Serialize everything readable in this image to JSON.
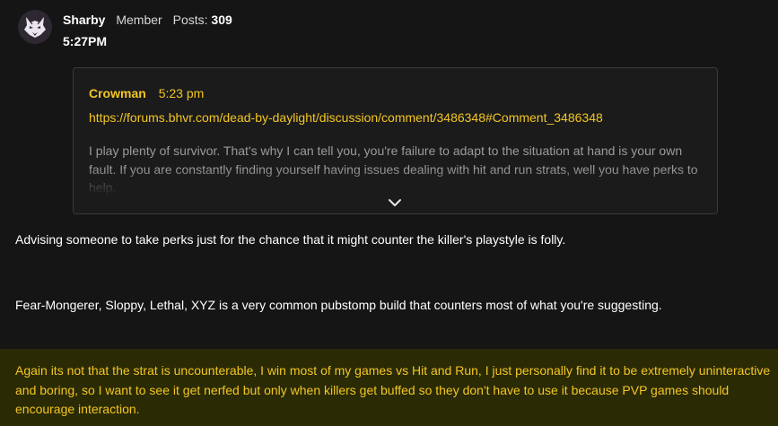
{
  "author": {
    "username": "Sharby",
    "role": "Member",
    "posts_label": "Posts:",
    "posts_count": "309",
    "timestamp": "5:27PM",
    "avatar_icon": "wolf-head-icon"
  },
  "quote": {
    "author": "Crowman",
    "time": "5:23 pm",
    "link": "https://forums.bhvr.com/dead-by-daylight/discussion/comment/3486348#Comment_3486348",
    "body": "I play plenty of survivor. That's why I can tell you, you're failure to adapt to the situation at hand is your own fault. If you are constantly finding yourself having issues dealing with hit and run strats, well you have perks to help.",
    "expand_icon": "chevron-down-icon"
  },
  "post": {
    "paragraph_1": "Advising someone to take perks just for the chance that it might counter the killer's playstyle is folly.",
    "paragraph_2": "Fear-Mongerer, Sloppy, Lethal, XYZ is a very common pubstomp build that counters most of what you're suggesting.",
    "paragraph_3": "Again its not that the strat is uncounterable, I win most of my games vs Hit and Run, I just personally find it to be extremely uninteractive and boring, so I want to see it get nerfed but only when killers get buffed so they don't have to use it because PVP games should encourage interaction."
  },
  "colors": {
    "background": "#151515",
    "accent": "#f3c623",
    "highlight_bg": "#2a2a04"
  }
}
